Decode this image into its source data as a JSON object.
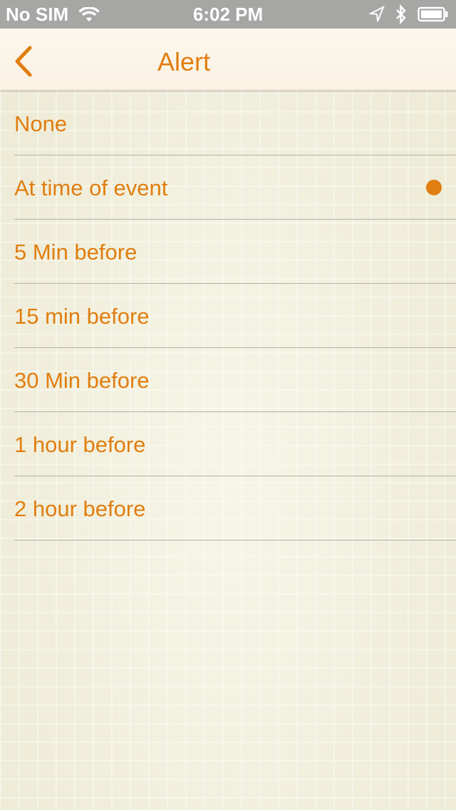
{
  "status_bar": {
    "carrier": "No SIM",
    "time": "6:02 PM",
    "icons": [
      "wifi-icon",
      "location-arrow-icon",
      "bluetooth-icon",
      "battery-icon"
    ]
  },
  "nav": {
    "back_icon": "chevron-left-icon",
    "title": "Alert"
  },
  "colors": {
    "accent": "#e07e10",
    "status_bar_bg": "#a6a6a4",
    "nav_bg": "#fbf5e8",
    "separator": "#b3b1a5"
  },
  "alert_options": [
    {
      "label": "None",
      "selected": false
    },
    {
      "label": "At time of event",
      "selected": true
    },
    {
      "label": "5 Min before",
      "selected": false
    },
    {
      "label": "15 min before",
      "selected": false
    },
    {
      "label": "30 Min before",
      "selected": false
    },
    {
      "label": "1 hour before",
      "selected": false
    },
    {
      "label": "2 hour before",
      "selected": false
    }
  ]
}
